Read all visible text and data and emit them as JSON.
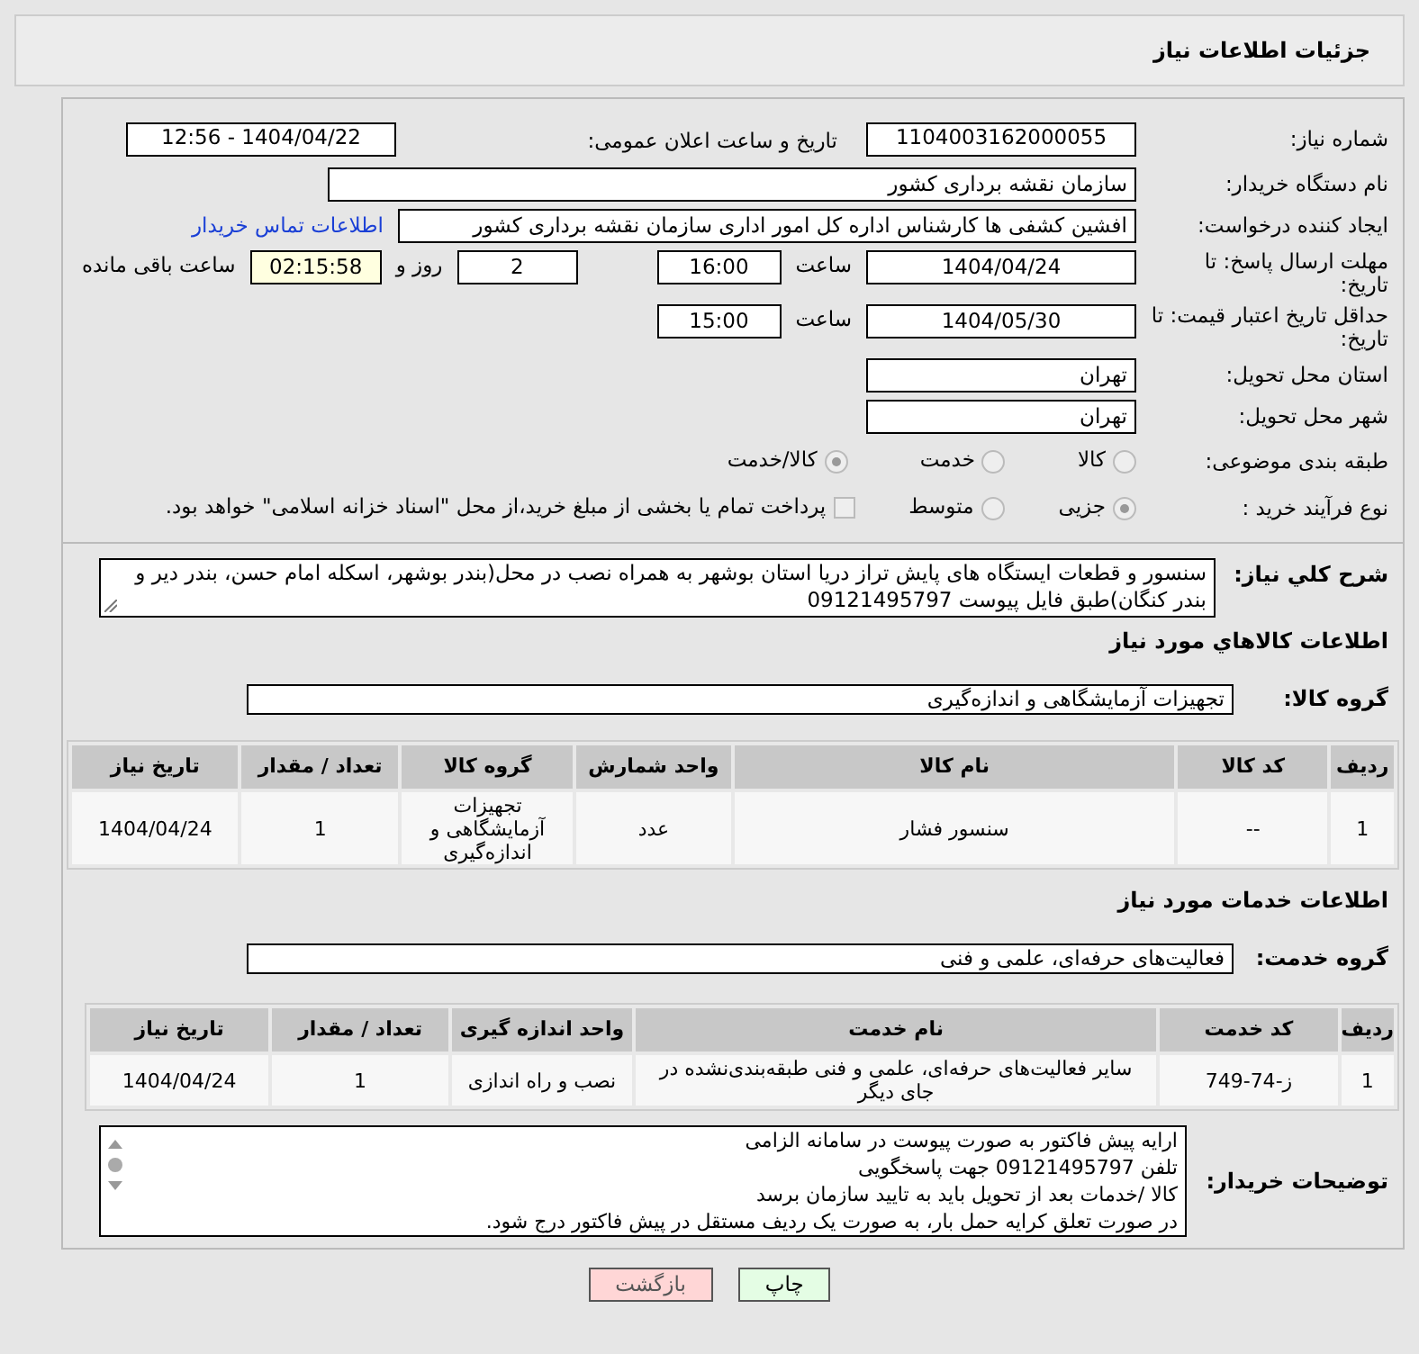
{
  "title": "جزئیات اطلاعات نیاز",
  "need_number": {
    "label": "شماره نیاز:",
    "value": "1104003162000055"
  },
  "announce": {
    "label": "تاریخ و ساعت اعلان عمومی:",
    "value": "1404/04/22 - 12:56"
  },
  "buyer": {
    "label": "نام دستگاه خریدار:",
    "value": "سازمان نقشه برداری کشور"
  },
  "creator": {
    "label": "ایجاد کننده درخواست:",
    "value": "افشین کشفی ها کارشناس اداره کل امور اداری سازمان نقشه برداری کشور",
    "link": "اطلاعات تماس خریدار"
  },
  "deadline": {
    "label": "مهلت ارسال پاسخ: تا تاریخ:",
    "date": "1404/04/24",
    "time_label": "ساعت",
    "time": "16:00",
    "days": "2",
    "days_label": "روز و",
    "remaining": "02:15:58",
    "remaining_label": "ساعت باقی مانده"
  },
  "validity": {
    "label": "حداقل تاریخ اعتبار قیمت: تا تاریخ:",
    "date": "1404/05/30",
    "time_label": "ساعت",
    "time": "15:00"
  },
  "province": {
    "label": "استان محل تحویل:",
    "value": "تهران"
  },
  "city": {
    "label": "شهر محل تحویل:",
    "value": "تهران"
  },
  "category": {
    "label": "طبقه بندی موضوعی:",
    "options": [
      {
        "label": "کالا",
        "selected": false
      },
      {
        "label": "خدمت",
        "selected": false
      },
      {
        "label": "کالا/خدمت",
        "selected": true
      }
    ]
  },
  "purchase_type": {
    "label": "نوع فرآیند خرید :",
    "options": [
      {
        "label": "جزیی",
        "selected": true
      },
      {
        "label": "متوسط",
        "selected": false
      }
    ],
    "payment": {
      "label": "پرداخت تمام یا بخشی از مبلغ خرید،از محل \"اسناد خزانه اسلامی\" خواهد بود.",
      "checked": false
    }
  },
  "description": {
    "label": "شرح كلي نياز:",
    "value": "سنسور و قطعات ایستگاه های پایش تراز دریا استان بوشهر به همراه نصب در محل(بندر بوشهر، اسکله امام حسن، بندر دیر و بندر کنگان)طبق فایل پیوست 09121495797"
  },
  "goods": {
    "title": "اطلاعات كالاهاي مورد نياز",
    "group_label": "گروه کالا:",
    "group": "تجهیزات آزمایشگاهی و اندازه‌گیری",
    "columns": [
      "ردیف",
      "کد کالا",
      "نام کالا",
      "واحد شمارش",
      "گروه کالا",
      "تعداد / مقدار",
      "تاریخ نیاز"
    ],
    "rows": [
      [
        "1",
        "--",
        "سنسور فشار",
        "عدد",
        "تجهیزات آزمایشگاهی و اندازه‌گیری",
        "1",
        "1404/04/24"
      ]
    ]
  },
  "services": {
    "title": "اطلاعات خدمات مورد نیاز",
    "group_label": "گروه خدمت:",
    "group": "فعالیت‌های حرفه‌ای، علمی و فنی",
    "columns": [
      "ردیف",
      "کد خدمت",
      "نام خدمت",
      "واحد اندازه گیری",
      "تعداد / مقدار",
      "تاریخ نیاز"
    ],
    "rows": [
      [
        "1",
        "ز-74-749",
        "سایر فعالیت‌های حرفه‌ای، علمی و فنی طبقه‌بندی‌نشده در جای دیگر",
        "نصب و راه اندازی",
        "1",
        "1404/04/24"
      ]
    ]
  },
  "buyer_notes": {
    "label": "توضیحات خریدار:",
    "lines": [
      "ارایه پیش فاکتور به صورت پیوست در سامانه الزامی",
      "تلفن  09121495797 جهت پاسخگویی",
      "کالا /خدمات بعد از تحویل باید به تایید سازمان برسد",
      "در صورت تعلق کرایه حمل بار، به صورت یک ردیف مستقل در پیش فاکتور درج شود."
    ]
  },
  "buttons": [
    {
      "label": "چاپ",
      "kind": "print"
    },
    {
      "label": "بازگشت",
      "kind": "back"
    }
  ]
}
